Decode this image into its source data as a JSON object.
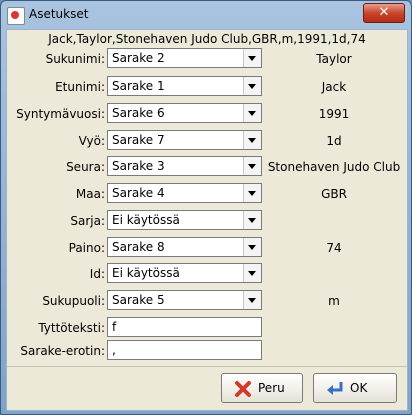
{
  "window": {
    "title": "Asetukset",
    "close_glyph": "✕"
  },
  "header": {
    "record": "Jack,Taylor,Stonehaven Judo Club,GBR,m,1991,1d,74"
  },
  "mappings": [
    {
      "label": "Sukunimi:",
      "column": "Sarake 2",
      "value": "Taylor"
    },
    {
      "label": "Etunimi:",
      "column": "Sarake 1",
      "value": "Jack"
    },
    {
      "label": "Syntymävuosi:",
      "column": "Sarake 6",
      "value": "1991"
    },
    {
      "label": "Vyö:",
      "column": "Sarake 7",
      "value": "1d"
    },
    {
      "label": "Seura:",
      "column": "Sarake 3",
      "value": "Stonehaven Judo Club"
    },
    {
      "label": "Maa:",
      "column": "Sarake 4",
      "value": "GBR"
    },
    {
      "label": "Sarja:",
      "column": "Ei käytössä",
      "value": ""
    },
    {
      "label": "Paino:",
      "column": "Sarake 8",
      "value": "74"
    },
    {
      "label": "Id:",
      "column": "Ei käytössä",
      "value": ""
    },
    {
      "label": "Sukupuoli:",
      "column": "Sarake 5",
      "value": "m"
    }
  ],
  "text_fields": {
    "girl_text": {
      "label": "Tyttöteksti:",
      "value": "f"
    },
    "separator": {
      "label": "Sarake-erotin:",
      "value": ","
    }
  },
  "buttons": {
    "cancel": "Peru",
    "ok": "OK"
  },
  "colors": {
    "close_button": "#c9452b",
    "cancel_icon": "#d23b2b",
    "ok_icon": "#3b6fc4"
  }
}
